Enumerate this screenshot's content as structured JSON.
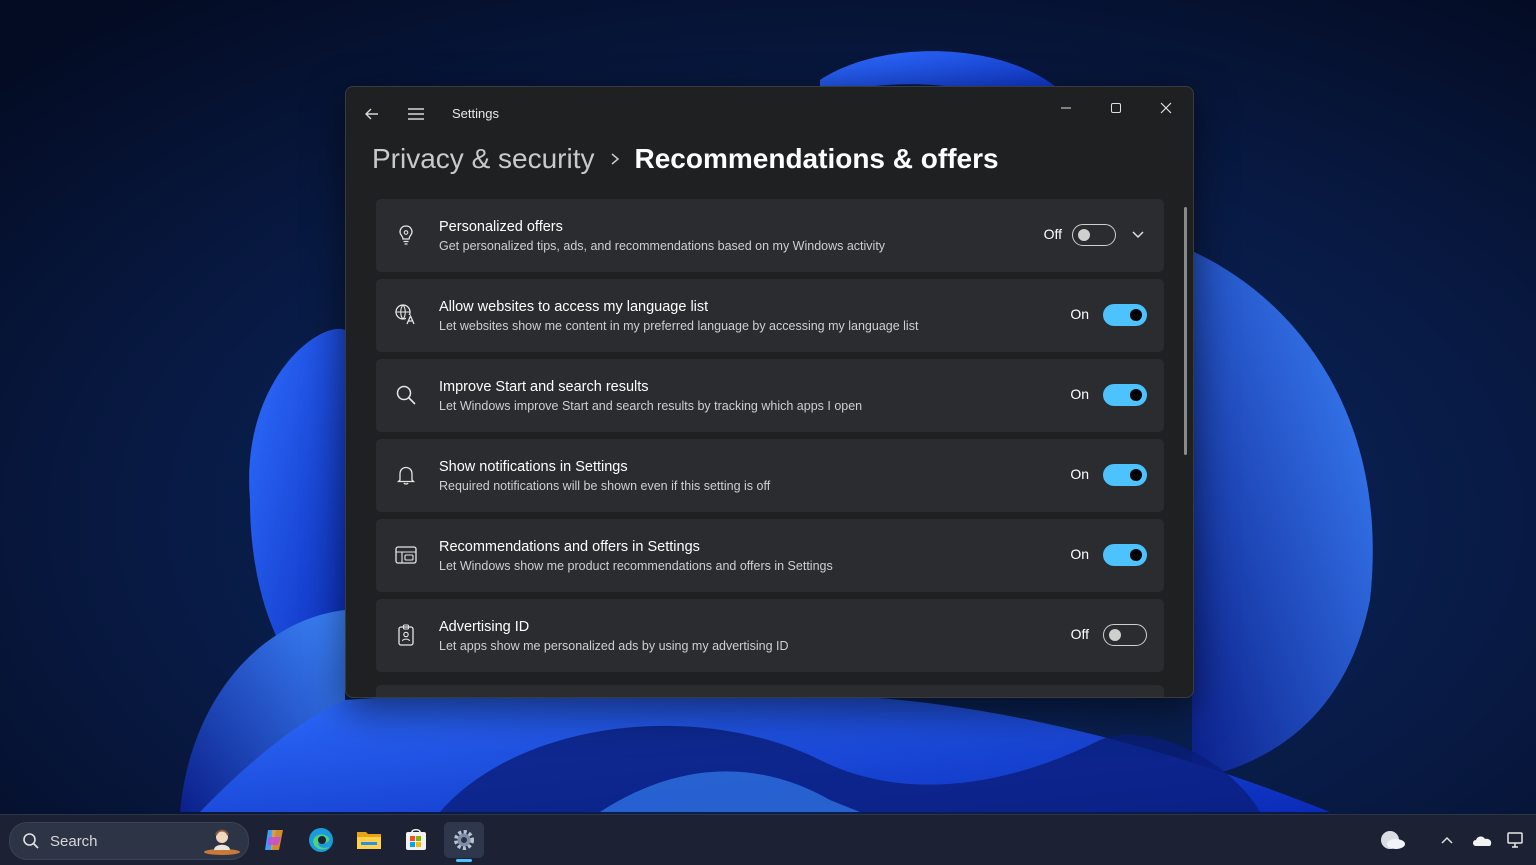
{
  "window": {
    "app_title": "Settings",
    "breadcrumb_parent": "Privacy & security",
    "breadcrumb_current": "Recommendations & offers",
    "controls": {
      "minimize": "minimize-icon",
      "maximize": "maximize-icon",
      "close": "close-icon"
    }
  },
  "settings": [
    {
      "icon": "lightbulb-icon",
      "title": "Personalized offers",
      "description": "Get personalized tips, ads, and recommendations based on my Windows activity",
      "state": "Off",
      "on": false,
      "expandable": true
    },
    {
      "icon": "language-icon",
      "title": "Allow websites to access my language list",
      "description": "Let websites show me content in my preferred language by accessing my language list",
      "state": "On",
      "on": true
    },
    {
      "icon": "search-icon",
      "title": "Improve Start and search results",
      "description": "Let Windows improve Start and search results by tracking which apps I open",
      "state": "On",
      "on": true
    },
    {
      "icon": "bell-icon",
      "title": "Show notifications in Settings",
      "description": "Required notifications will be shown even if this setting is off",
      "state": "On",
      "on": true
    },
    {
      "icon": "offers-icon",
      "title": "Recommendations and offers in Settings",
      "description": "Let Windows show me product recommendations and offers in Settings",
      "state": "On",
      "on": true
    },
    {
      "icon": "id-badge-icon",
      "title": "Advertising ID",
      "description": "Let apps show me personalized ads by using my advertising ID",
      "state": "Off",
      "on": false
    }
  ],
  "taskbar": {
    "search_label": "Search",
    "apps": [
      "copilot-icon",
      "edge-icon",
      "file-explorer-icon",
      "store-icon",
      "settings-icon"
    ],
    "active_app": "settings-icon",
    "tray": [
      "weather-icon",
      "show-hidden-icons-icon",
      "onedrive-icon",
      "network-icon"
    ]
  },
  "colors": {
    "accent": "#4cc2ff",
    "card": "#2b2c2f",
    "window": "#1f2022"
  }
}
